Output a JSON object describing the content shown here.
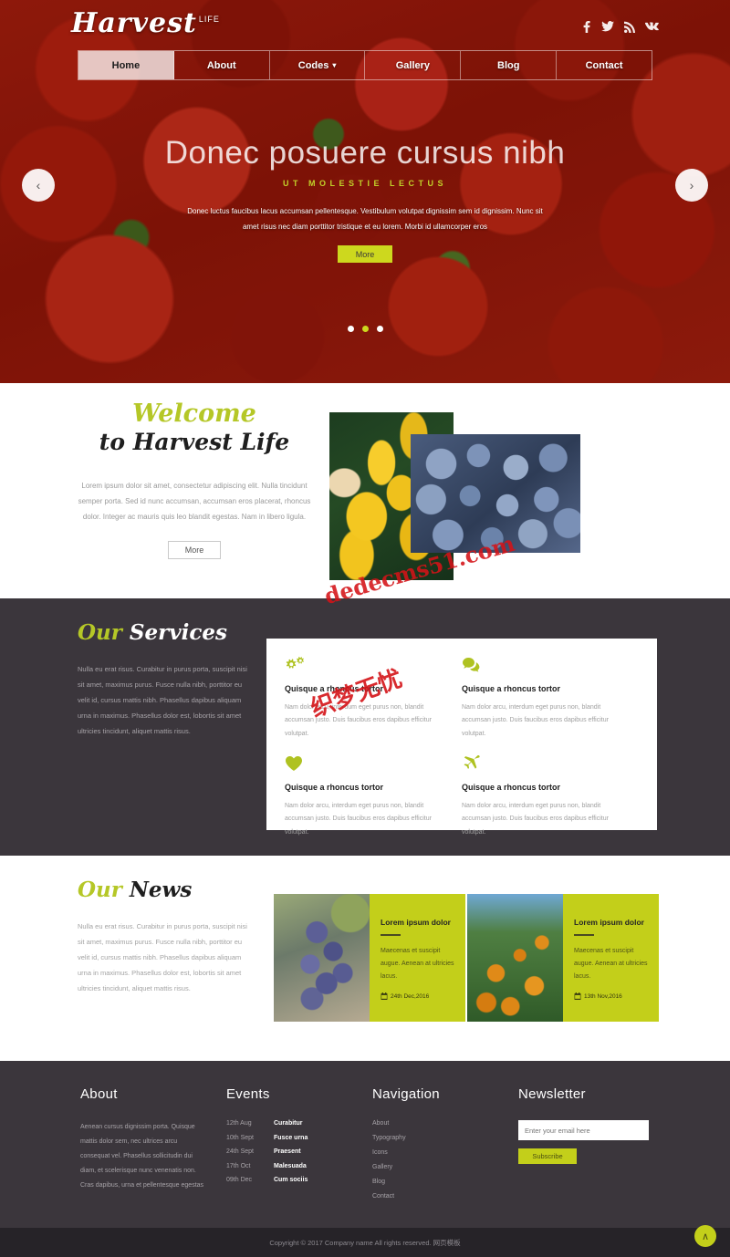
{
  "header": {
    "logo_text": "Harvest",
    "logo_sup": "LIFE",
    "socials": [
      {
        "name": "facebook-icon",
        "glyph": "f"
      },
      {
        "name": "twitter-icon",
        "glyph": "t"
      },
      {
        "name": "rss-icon",
        "glyph": "r"
      },
      {
        "name": "vk-icon",
        "glyph": "vk"
      }
    ],
    "nav": [
      {
        "label": "Home",
        "active": true
      },
      {
        "label": "About",
        "active": false
      },
      {
        "label": "Codes",
        "active": false,
        "caret": "▾"
      },
      {
        "label": "Gallery",
        "active": false
      },
      {
        "label": "Blog",
        "active": false
      },
      {
        "label": "Contact",
        "active": false
      }
    ]
  },
  "hero": {
    "title": "Donec posuere cursus nibh",
    "subtitle": "UT MOLESTIE LECTUS",
    "description": "Donec luctus faucibus lacus accumsan pellentesque. Vestibulum volutpat dignissim sem id dignissim. Nunc sit amet risus nec diam porttitor tristique et eu lorem. Morbi id ullamcorper eros",
    "button": "More",
    "arrow_prev": "‹",
    "arrow_next": "›",
    "dots": 3,
    "active_dot": 1
  },
  "welcome": {
    "heading_line1": "Welcome",
    "heading_line2": "to Harvest Life",
    "body": "Lorem ipsum dolor sit amet, consectetur adipiscing elit. Nulla tincidunt semper porta. Sed id nunc accumsan, accumsan eros placerat, rhoncus dolor. Integer ac mauris quis leo blandit egestas. Nam in libero ligula.",
    "button": "More"
  },
  "services": {
    "heading_a": "Our",
    "heading_b": "Services",
    "body": "Nulla eu erat risus. Curabitur in purus porta, suscipit nisi sit amet, maximus purus. Fusce nulla nibh, porttitor eu velit id, cursus mattis nibh. Phasellus dapibus aliquam urna in maximus. Phasellus dolor est, lobortis sit amet ultricies tincidunt, aliquet mattis risus.",
    "cards": [
      {
        "icon": "gears-icon",
        "title": "Quisque a rhoncus tortor",
        "desc": "Nam dolor arcu, interdum eget purus non, blandit accumsan justo. Duis faucibus eros dapibus efficitur volutpat."
      },
      {
        "icon": "chat-bubble-icon",
        "title": "Quisque a rhoncus tortor",
        "desc": "Nam dolor arcu, interdum eget purus non, blandit accumsan justo. Duis faucibus eros dapibus efficitur volutpat."
      },
      {
        "icon": "heart-icon",
        "title": "Quisque a rhoncus tortor",
        "desc": "Nam dolor arcu, interdum eget purus non, blandit accumsan justo. Duis faucibus eros dapibus efficitur volutpat."
      },
      {
        "icon": "plane-icon",
        "title": "Quisque a rhoncus tortor",
        "desc": "Nam dolor arcu, interdum eget purus non, blandit accumsan justo. Duis faucibus eros dapibus efficitur volutpat."
      }
    ]
  },
  "news": {
    "heading_a": "Our",
    "heading_b": "News",
    "body": "Nulla eu erat risus. Curabitur in purus porta, suscipit nisi sit amet, maximus purus. Fusce nulla nibh, porttitor eu velit id, cursus mattis nibh. Phasellus dapibus aliquam urna in maximus. Phasellus dolor est, lobortis sit amet ultricies tincidunt, aliquet mattis risus.",
    "cards": [
      {
        "image": "grapes-image",
        "title": "Lorem ipsum dolor",
        "desc": "Maecenas et suscipit augue. Aenean at ultricies lacus.",
        "date": "24th Dec,2016"
      },
      {
        "image": "oranges-image",
        "title": "Lorem ipsum dolor",
        "desc": "Maecenas et suscipit augue. Aenean at ultricies lacus.",
        "date": "13th Nov,2016"
      }
    ]
  },
  "footer": {
    "about": {
      "title": "About",
      "body": "Aenean cursus dignissim porta. Quisque mattis dolor sem, nec ultrices arcu consequat vel. Phasellus sollicitudin dui diam, et scelerisque nunc venenatis non. Cras dapibus, urna et pellentesque egestas"
    },
    "events": {
      "title": "Events",
      "items": [
        {
          "date": "12th Aug",
          "name": "Curabitur"
        },
        {
          "date": "10th Sept",
          "name": "Fusce urna"
        },
        {
          "date": "24th Sept",
          "name": "Praesent"
        },
        {
          "date": "17th Oct",
          "name": "Malesuada"
        },
        {
          "date": "09th Dec",
          "name": "Cum sociis"
        }
      ]
    },
    "navigation": {
      "title": "Navigation",
      "links": [
        "About",
        "Typography",
        "Icons",
        "Gallery",
        "Blog",
        "Contact"
      ]
    },
    "newsletter": {
      "title": "Newsletter",
      "placeholder": "Enter your email here",
      "value": "",
      "button": "Subscribe"
    }
  },
  "copyright": {
    "text": "Copyright © 2017 Company name All rights reserved. 网页模板",
    "to_top": "∧"
  },
  "watermark": {
    "line1": "织梦无忧",
    "line2": "dedecms51.com"
  },
  "colors": {
    "accent_green": "#c3cf1a",
    "dark_panel": "#3b363c",
    "copy_bar": "#262328",
    "script_green": "#b5c727"
  }
}
